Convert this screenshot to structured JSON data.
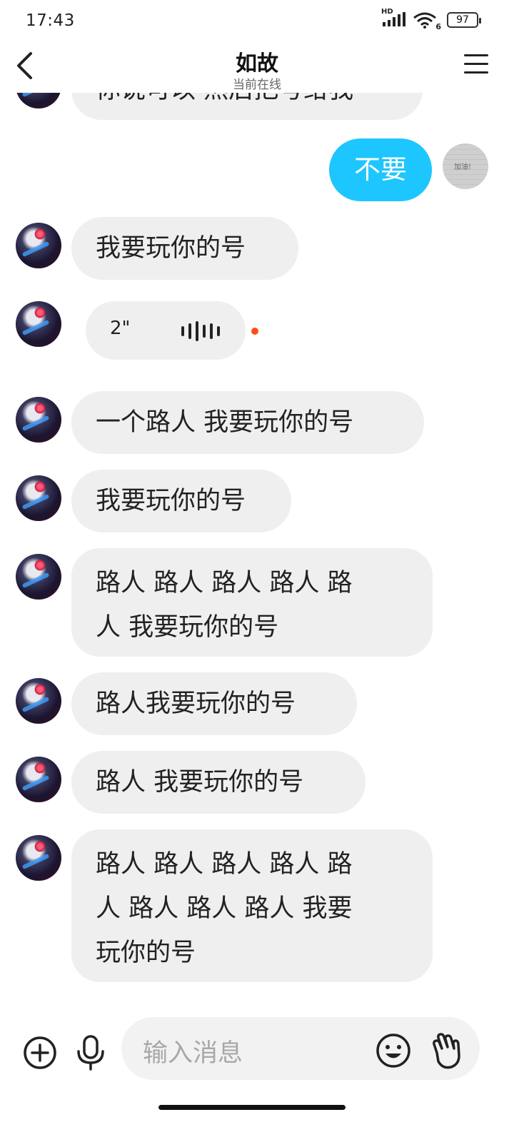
{
  "status_bar": {
    "time": "17:43",
    "network_label": "HD",
    "wifi_label": "6",
    "battery": "97"
  },
  "header": {
    "title": "如故",
    "subtitle": "当前在线",
    "back_icon": "chevron-left-icon",
    "menu_icon": "hamburger-menu-icon"
  },
  "messages": [
    {
      "sender": "them",
      "type": "text",
      "text": "你说可以 然后把号给我"
    },
    {
      "sender": "me",
      "type": "text",
      "text": "不要",
      "avatar_note": "加油!"
    },
    {
      "sender": "them",
      "type": "text",
      "text": "我要玩你的号"
    },
    {
      "sender": "them",
      "type": "voice",
      "duration": "2\"",
      "unread": true
    },
    {
      "sender": "them",
      "type": "text",
      "text": "一个路人 我要玩你的号"
    },
    {
      "sender": "them",
      "type": "text",
      "text": "我要玩你的号"
    },
    {
      "sender": "them",
      "type": "text",
      "lines": [
        "路人 路人 路人 路人 路",
        "人 我要玩你的号"
      ]
    },
    {
      "sender": "them",
      "type": "text",
      "text": "路人我要玩你的号"
    },
    {
      "sender": "them",
      "type": "text",
      "text": "路人 我要玩你的号"
    },
    {
      "sender": "them",
      "type": "text",
      "lines": [
        "路人 路人 路人 路人 路",
        "人 路人 路人 路人 我要",
        "玩你的号"
      ]
    }
  ],
  "input_bar": {
    "placeholder": "输入消息",
    "add_icon": "plus-circle-icon",
    "mic_icon": "microphone-icon",
    "emoji_icon": "smiley-icon",
    "hand_icon": "hand-wave-icon"
  },
  "colors": {
    "my_bubble": "#1ec6ff",
    "their_bubble": "#efefef",
    "unread_dot": "#ff4a1c"
  }
}
